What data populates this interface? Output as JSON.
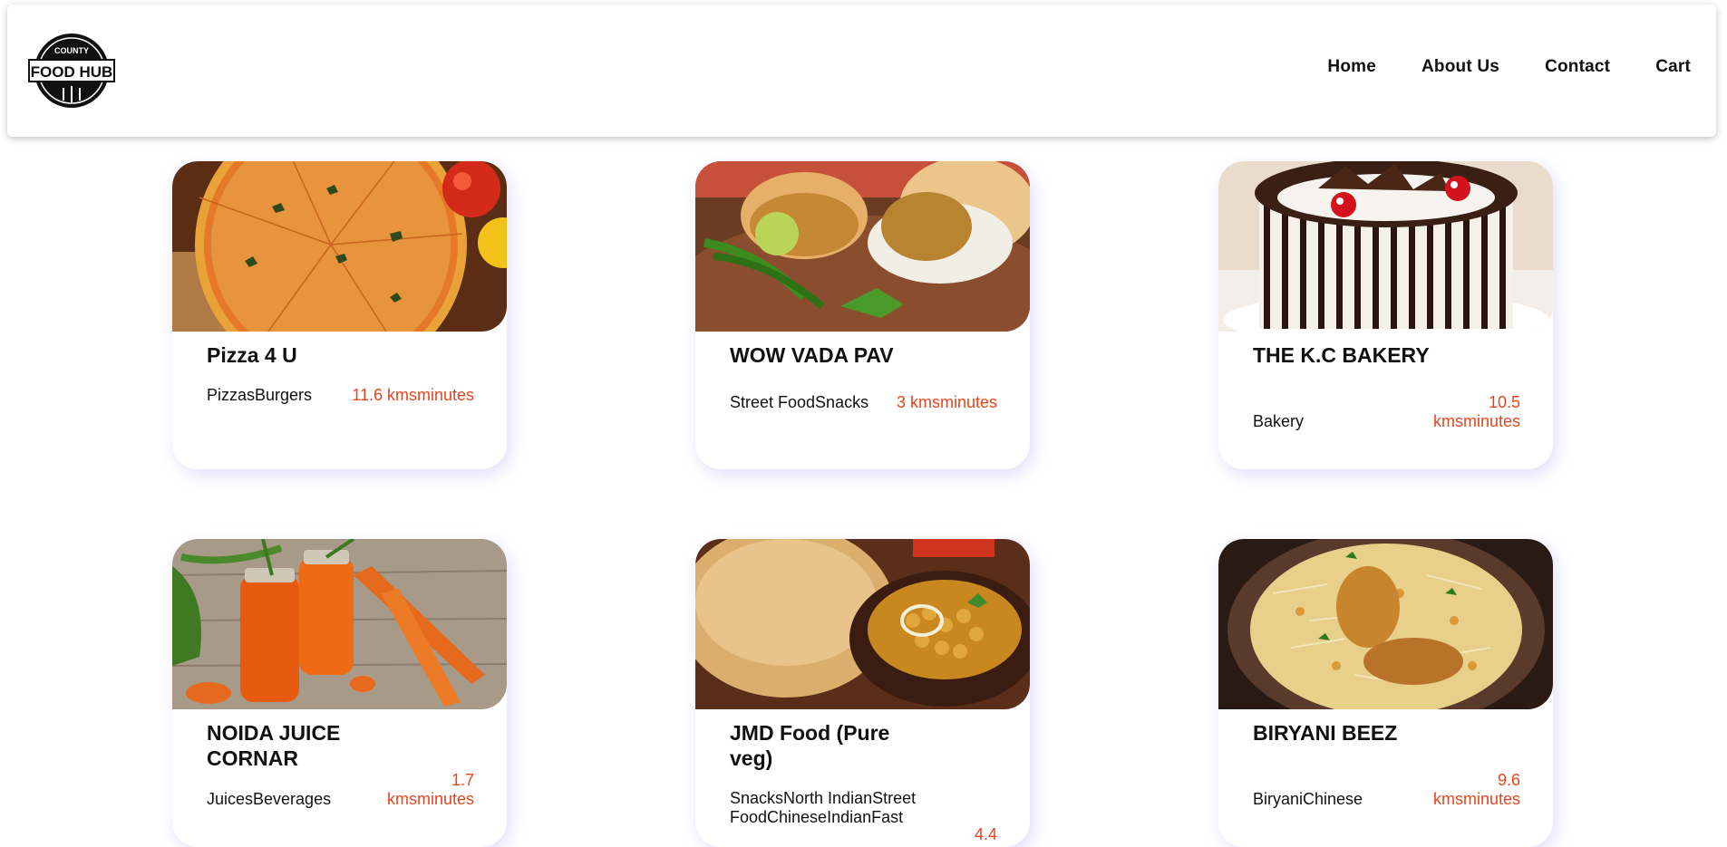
{
  "header": {
    "logo": {
      "top_text": "COUNTY",
      "main_text": "FOOD HUB"
    },
    "nav": [
      {
        "label": "Home"
      },
      {
        "label": "About Us"
      },
      {
        "label": "Contact"
      },
      {
        "label": "Cart"
      }
    ]
  },
  "restaurants": [
    {
      "name": "Pizza 4 U",
      "cuisine": "PizzasBurgers",
      "distance": "11.6 kmsminutes",
      "image": "pizza"
    },
    {
      "name": "WOW VADA PAV",
      "cuisine": "Street FoodSnacks",
      "distance": "3 kmsminutes",
      "image": "vada-pav"
    },
    {
      "name": "THE K.C BAKERY",
      "cuisine": "Bakery",
      "distance": "10.5 kmsminutes",
      "image": "cake"
    },
    {
      "name": "NOIDA JUICE CORNAR",
      "cuisine": "JuicesBeverages",
      "distance": "1.7 kmsminutes",
      "image": "juice"
    },
    {
      "name": "JMD Food (Pure veg)",
      "cuisine": "SnacksNorth IndianStreet FoodChineseIndianFast",
      "distance": "4.4",
      "image": "chole-bhature"
    },
    {
      "name": "BIRYANI BEEZ",
      "cuisine": "BiryaniChinese",
      "distance": "9.6 kmsminutes",
      "image": "biryani"
    }
  ],
  "colors": {
    "accent": "#e5451c",
    "card_shadow": "#786ef0"
  }
}
